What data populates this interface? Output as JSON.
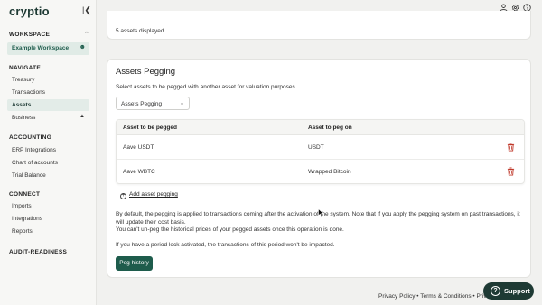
{
  "app": {
    "logo": "cryptio"
  },
  "sidebar": {
    "workspace_heading": "WORKSPACE",
    "workspace_name": "Example Workspace",
    "navigate_heading": "NAVIGATE",
    "navigate_items": [
      {
        "label": "Treasury"
      },
      {
        "label": "Transactions"
      },
      {
        "label": "Assets",
        "active": true
      },
      {
        "label": "Business"
      }
    ],
    "accounting_heading": "ACCOUNTING",
    "accounting_items": [
      {
        "label": "ERP Integrations"
      },
      {
        "label": "Chart of accounts"
      },
      {
        "label": "Trial Balance"
      }
    ],
    "connect_heading": "CONNECT",
    "connect_items": [
      {
        "label": "Imports"
      },
      {
        "label": "Integrations"
      },
      {
        "label": "Reports"
      }
    ],
    "audit_heading": "AUDIT-READINESS"
  },
  "top_card": {
    "assets_count_text": "5 assets displayed"
  },
  "pegging": {
    "title": "Assets Pegging",
    "subtitle": "Select assets to be pegged with another asset for valuation purposes.",
    "dropdown_value": "Assets Pegging",
    "columns": [
      "Asset to be pegged",
      "Asset to peg on"
    ],
    "rows": [
      {
        "pegged": "Aave USDT",
        "peg_on": "USDT"
      },
      {
        "pegged": "Aave WBTC",
        "peg_on": "Wrapped Bitcoin"
      }
    ],
    "add_label": "Add asset pegging",
    "info_line1": "By default, the pegging is applied to transactions coming after the activation of the system. Note that if you apply the pegging system on past transactions, it will update their cost basis.",
    "info_line2": "You can't un-peg the historical prices of your pegged assets once this operation is done.",
    "info_line3": "If you have a period lock activated, the transactions of this period won't be impacted.",
    "button_label": "Peg history"
  },
  "footer": {
    "text": "Privacy Policy • Terms & Conditions • Privacy Settings"
  },
  "support": {
    "label": "Support"
  },
  "colors": {
    "primary": "#1e5c4c",
    "dark": "#1e3a34",
    "delete": "#c0392b"
  }
}
